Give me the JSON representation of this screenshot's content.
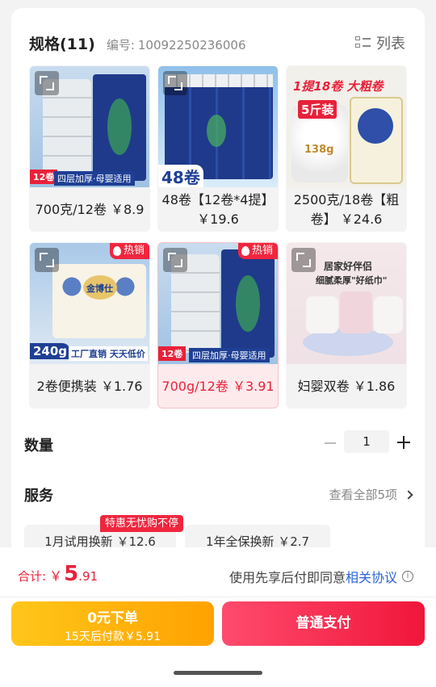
{
  "spec": {
    "title": "规格(11)",
    "code_label": "编号:",
    "code": "10092250236006",
    "list_toggle": "列表"
  },
  "products": [
    {
      "label": "700克/12卷 ￥8.9",
      "selected": false,
      "hot": false,
      "tag": "12卷",
      "banner": "四层加厚·母婴适用"
    },
    {
      "label": "48卷【12卷*4提】 ￥19.6",
      "selected": false,
      "hot": false,
      "tag": "48卷"
    },
    {
      "label": "2500克/18卷【粗卷】 ￥24.6",
      "selected": false,
      "hot": false,
      "tag": "1提18卷 大粗卷",
      "tag2": "5斤装",
      "weight": "138g"
    },
    {
      "label": "2卷便携装 ￥1.76",
      "selected": false,
      "hot": true,
      "hot_text": "热销",
      "tag": "240g",
      "banner": "工厂直销 天天低价",
      "brand": "金博仕"
    },
    {
      "label": "700g/12卷 ￥3.91",
      "selected": true,
      "hot": true,
      "hot_text": "热销",
      "tag": "12卷",
      "banner": "四层加厚·母婴适用"
    },
    {
      "label": "妇婴双卷 ￥1.86",
      "selected": false,
      "hot": false,
      "headline": "居家好伴侣",
      "subline": "细腻柔厚\"好纸巾\""
    }
  ],
  "quantity": {
    "title": "数量",
    "value": "1"
  },
  "services": {
    "title": "服务",
    "view_all": "查看全部5项",
    "items": [
      {
        "label": "1月试用换新 ￥12.6",
        "badge": "特惠无忧购不停"
      },
      {
        "label": "1年全保换新 ￥2.7"
      }
    ]
  },
  "footer": {
    "total_label": "合计:",
    "currency": "￥",
    "total_int": "5",
    "total_dec": ".91",
    "agree_text": "使用先享后付即同意",
    "agree_link": "相关协议",
    "pay_later_label": "0元下单",
    "pay_later_sub": "15天后付款￥5.91",
    "pay_label": "普通支付"
  },
  "colors": {
    "accent": "#f0263e",
    "price": "#e8213a",
    "pay_later": "#ffb40a",
    "link": "#2a64d6"
  }
}
